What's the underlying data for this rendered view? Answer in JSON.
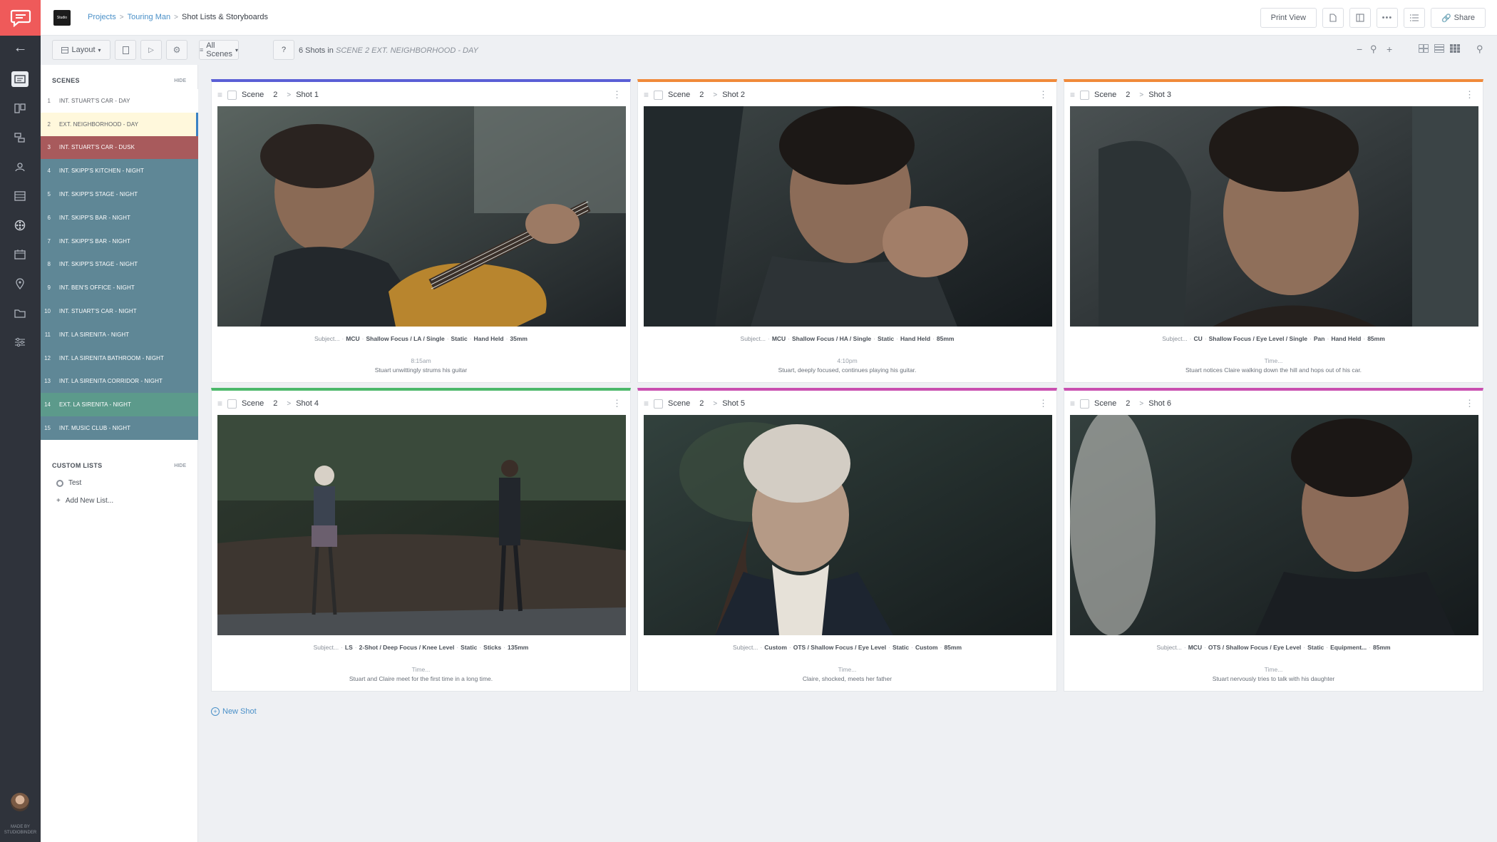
{
  "breadcrumb": {
    "projects": "Projects",
    "project": "Touring Man",
    "current": "Shot Lists & Storyboards"
  },
  "topbar": {
    "brand_text": "Studio",
    "print_view": "Print View",
    "share": "Share"
  },
  "toolbar": {
    "layout": "Layout",
    "all_scenes": "All Scenes",
    "help": "?",
    "shots_count": "6 Shots in",
    "shots_scene": "SCENE 2 EXT. NEIGHBORHOOD - DAY"
  },
  "scenes_panel": {
    "title": "SCENES",
    "hide": "HIDE",
    "items": [
      {
        "num": "1",
        "name": "INT. STUART'S CAR - DAY",
        "color": "#ffffff"
      },
      {
        "num": "2",
        "name": "EXT. NEIGHBORHOOD - DAY",
        "color": "#fff8dc"
      },
      {
        "num": "3",
        "name": "INT. STUART'S CAR - DUSK",
        "color": "#a85a5c"
      },
      {
        "num": "4",
        "name": "INT. SKIPP'S KITCHEN - NIGHT",
        "color": "#5f8796"
      },
      {
        "num": "5",
        "name": "INT. SKIPP'S STAGE - NIGHT",
        "color": "#5f8796"
      },
      {
        "num": "6",
        "name": "INT. SKIPP'S BAR - NIGHT",
        "color": "#5f8796"
      },
      {
        "num": "7",
        "name": "INT. SKIPP'S BAR - NIGHT",
        "color": "#5f8796"
      },
      {
        "num": "8",
        "name": "INT. SKIPP'S STAGE - NIGHT",
        "color": "#5f8796"
      },
      {
        "num": "9",
        "name": "INT. BEN'S OFFICE - NIGHT",
        "color": "#5f8796"
      },
      {
        "num": "10",
        "name": "INT. STUART'S CAR - NIGHT",
        "color": "#5f8796"
      },
      {
        "num": "11",
        "name": "INT. LA SIRENITA - NIGHT",
        "color": "#5f8796"
      },
      {
        "num": "12",
        "name": "INT. LA SIRENITA BATHROOM - NIGHT",
        "color": "#5f8796"
      },
      {
        "num": "13",
        "name": "INT. LA SIRENITA CORRIDOR - NIGHT",
        "color": "#5f8796"
      },
      {
        "num": "14",
        "name": "EXT. LA SIRENITA - NIGHT",
        "color": "#5c9a8b"
      },
      {
        "num": "15",
        "name": "INT. MUSIC CLUB - NIGHT",
        "color": "#5f8796"
      }
    ]
  },
  "custom_lists": {
    "title": "CUSTOM LISTS",
    "hide": "HIDE",
    "items": [
      "Test"
    ],
    "add_label": "Add New List..."
  },
  "shots": [
    {
      "scene_label": "Scene",
      "scene_num": "2",
      "shot": "Shot 1",
      "color": "#5a5fd6",
      "subject": "Subject...",
      "size": "MCU",
      "framing": "Shallow Focus / LA / Single",
      "movement": "Static",
      "equipment": "Hand Held",
      "lens": "35mm",
      "time": "8:15am",
      "description": "Stuart unwittingly strums his guitar"
    },
    {
      "scene_label": "Scene",
      "scene_num": "2",
      "shot": "Shot 2",
      "color": "#f08a3a",
      "subject": "Subject...",
      "size": "MCU",
      "framing": "Shallow Focus / HA / Single",
      "movement": "Static",
      "equipment": "Hand Held",
      "lens": "85mm",
      "time": "4:10pm",
      "description": "Stuart, deeply focused, continues playing his guitar."
    },
    {
      "scene_label": "Scene",
      "scene_num": "2",
      "shot": "Shot 3",
      "color": "#f08a3a",
      "subject": "Subject...",
      "size": "CU",
      "framing": "Shallow Focus / Eye Level / Single",
      "movement": "Pan",
      "equipment": "Hand Held",
      "lens": "85mm",
      "time": "Time...",
      "description": "Stuart notices Claire walking down the hill and hops out of his car."
    },
    {
      "scene_label": "Scene",
      "scene_num": "2",
      "shot": "Shot 4",
      "color": "#4cb86a",
      "subject": "Subject...",
      "size": "LS",
      "framing": "2-Shot / Deep Focus / Knee Level",
      "movement": "Static",
      "equipment": "Sticks",
      "lens": "135mm",
      "time": "Time...",
      "description": "Stuart and Claire meet for the first time in a long time."
    },
    {
      "scene_label": "Scene",
      "scene_num": "2",
      "shot": "Shot 5",
      "color": "#c94fb0",
      "subject": "Subject...",
      "size": "Custom",
      "framing": "OTS / Shallow Focus / Eye Level",
      "movement": "Static",
      "equipment": "Custom",
      "lens": "85mm",
      "time": "Time...",
      "description": "Claire, shocked, meets her father"
    },
    {
      "scene_label": "Scene",
      "scene_num": "2",
      "shot": "Shot 6",
      "color": "#c94fb0",
      "subject": "Subject...",
      "size": "MCU",
      "framing": "OTS / Shallow Focus / Eye Level",
      "movement": "Static",
      "equipment": "Equipment...",
      "lens": "85mm",
      "time": "Time...",
      "description": "Stuart nervously tries to talk with his daughter"
    }
  ],
  "new_shot": "New Shot",
  "made_by": "MADE BY STUDIOBINDER"
}
